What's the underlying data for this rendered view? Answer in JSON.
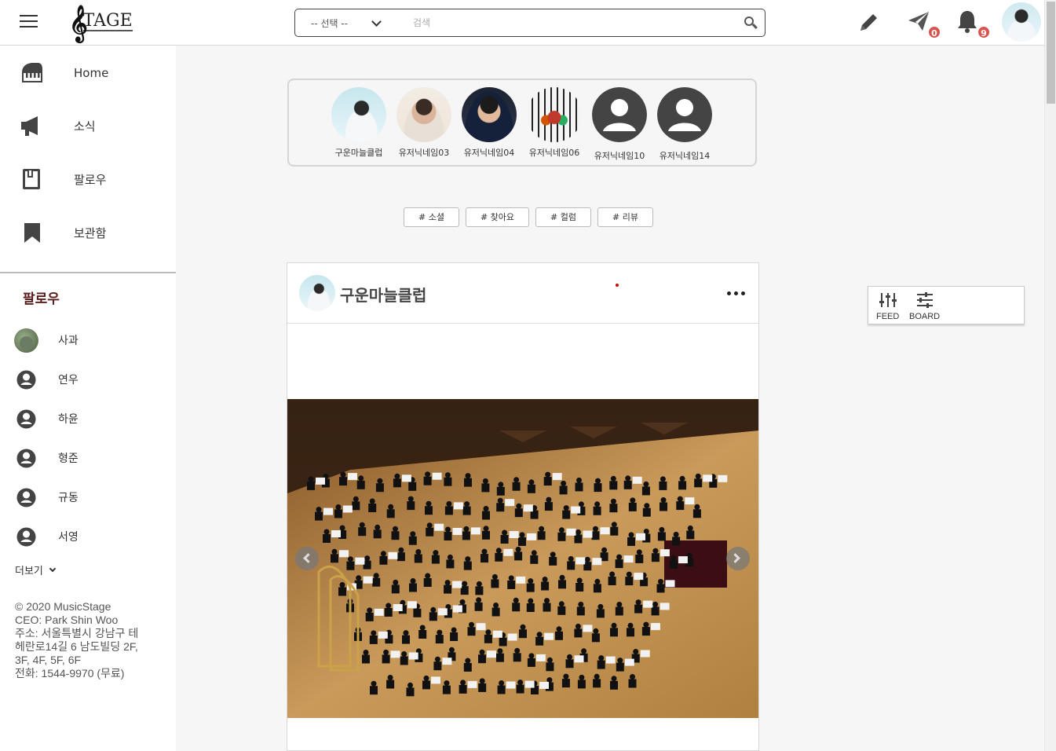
{
  "header": {
    "logo_clef": "𝄞",
    "logo_text": "TAGE",
    "search": {
      "select_value": "-- 선택 --",
      "placeholder": "검색",
      "value": ""
    },
    "messages_badge": "0",
    "notifications_badge": "9"
  },
  "sidebar": {
    "nav": [
      {
        "label": "Home",
        "icon": "piano-icon"
      },
      {
        "label": "소식",
        "icon": "megaphone-icon"
      },
      {
        "label": "팔로우",
        "icon": "book-icon"
      },
      {
        "label": "보관함",
        "icon": "bookmark-icon"
      }
    ],
    "follow_title": "팔로우",
    "follows": [
      {
        "name": "사과"
      },
      {
        "name": "연우"
      },
      {
        "name": "하윤"
      },
      {
        "name": "형준"
      },
      {
        "name": "규동"
      },
      {
        "name": "서영"
      }
    ],
    "more_label": "더보기",
    "footer": [
      "© 2020 MusicStage",
      "CEO: Park Shin Woo",
      "주소: 서울특별시 강남구 테",
      "헤란로14길 6 남도빌딩 2F,",
      "3F, 4F, 5F, 6F",
      "전화: 1544-9970 (무료)"
    ]
  },
  "stories": [
    {
      "name": "구운마늘클럽"
    },
    {
      "name": "유저닉네임03"
    },
    {
      "name": "유저닉네임04"
    },
    {
      "name": "유저닉네임06"
    },
    {
      "name": "유저닉네임10"
    },
    {
      "name": "유저닉네임14"
    }
  ],
  "tags": [
    "# 소셜",
    "# 찾아요",
    "# 컬럼",
    "# 리뷰"
  ],
  "post": {
    "author": "구운마늘클럽"
  },
  "view_toggle": {
    "feed_label": "FEED",
    "board_label": "BOARD"
  },
  "colors": {
    "badge": "#d9534f",
    "follow_title": "#5a1b1b",
    "stage_floor": "#c99a5a"
  }
}
